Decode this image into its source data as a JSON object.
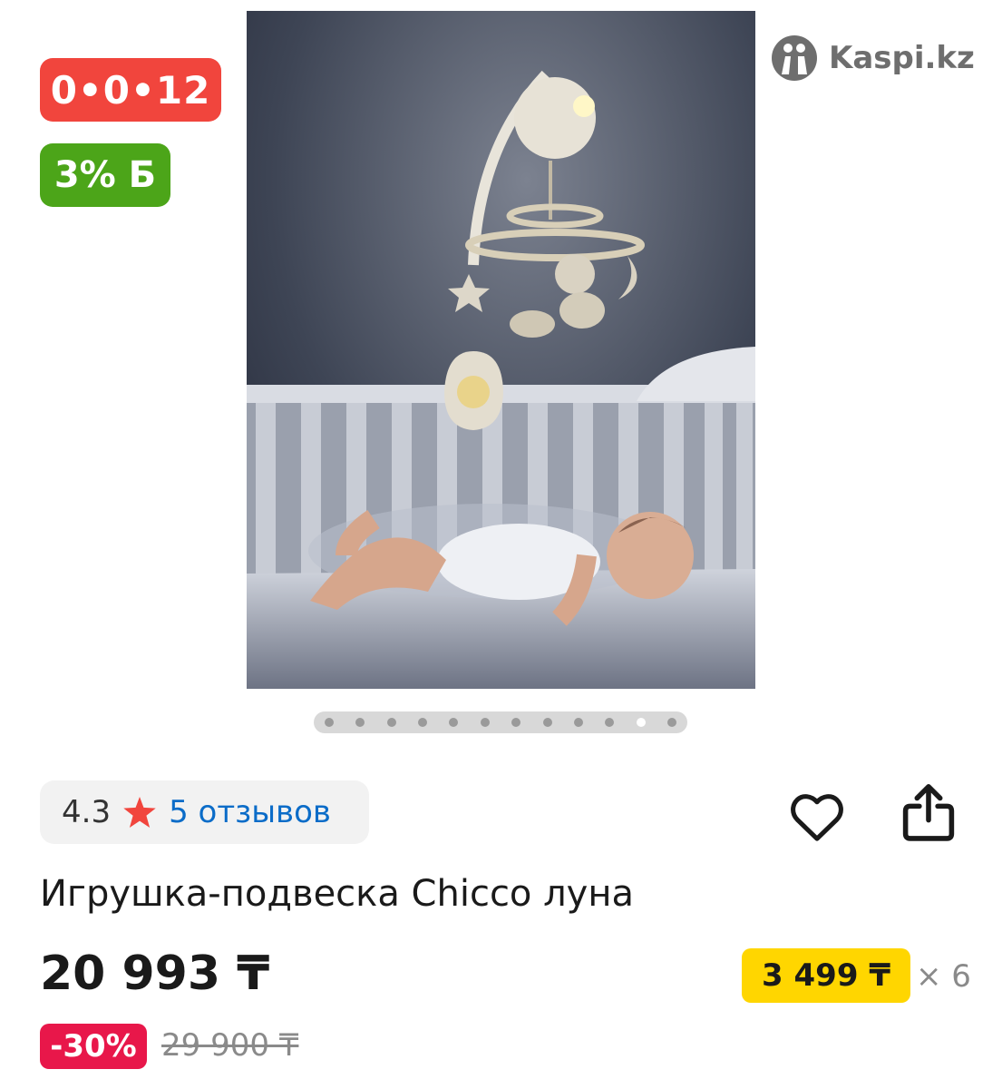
{
  "badges": {
    "installment": "0•0•12",
    "bonus": "3% Б"
  },
  "logo": {
    "text": "Kaspi.kz",
    "icon": "kaspi-logo-icon"
  },
  "gallery": {
    "dot_count": 12,
    "active_index": 10
  },
  "rating": {
    "value": "4.3",
    "star_icon": "star-icon",
    "star_color": "#f1453d",
    "reviews_link": "5 отзывов"
  },
  "actions": {
    "favorite_icon": "heart-icon",
    "share_icon": "share-icon"
  },
  "product": {
    "title": "Игрушка-подвеска Chicco луна",
    "price": "20 993 ₸",
    "monthly_payment": "3 499 ₸",
    "months": "× 6",
    "discount": "-30%",
    "old_price": "29 900 ₸"
  },
  "colors": {
    "installment": "#f1453d",
    "bonus": "#4ca519",
    "monthly": "#ffd600",
    "discount": "#e8174a",
    "link": "#0b6cc8"
  }
}
